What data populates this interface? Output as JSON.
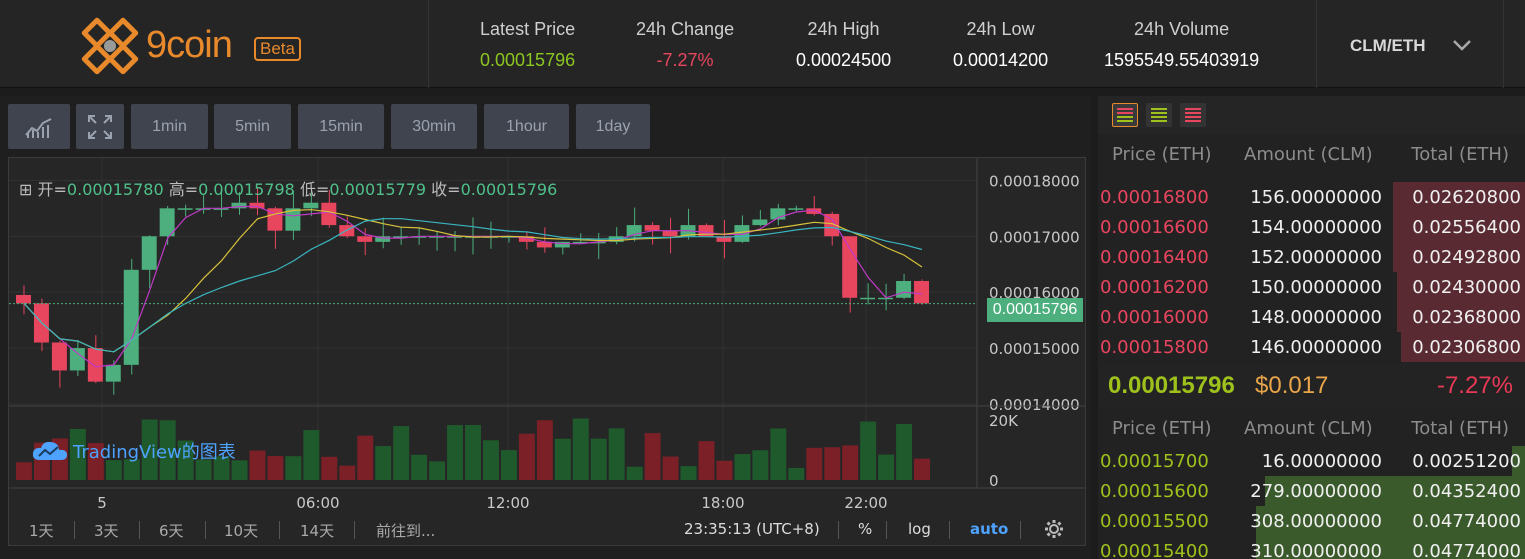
{
  "brand": {
    "name": "9coin",
    "badge": "Beta"
  },
  "ticker": {
    "latest_price": {
      "label": "Latest Price",
      "value": "0.00015796",
      "color": "#8cc620"
    },
    "change_24h": {
      "label": "24h Change",
      "value": "-7.27%",
      "color": "#e8455e"
    },
    "high_24h": {
      "label": "24h High",
      "value": "0.00024500",
      "color": "#ffffff"
    },
    "low_24h": {
      "label": "24h Low",
      "value": "0.00014200",
      "color": "#ffffff"
    },
    "volume_24h": {
      "label": "24h Volume",
      "value": "1595549.55403919",
      "color": "#ffffff"
    }
  },
  "pair": {
    "label": "CLM/ETH"
  },
  "toolbar": {
    "intervals": [
      "1min",
      "5min",
      "15min",
      "30min",
      "1hour",
      "1day"
    ]
  },
  "chart": {
    "ohlc": {
      "open_label": "开=",
      "open": "0.00015780",
      "high_label": "高=",
      "high": "0.00015798",
      "low_label": "低=",
      "low": "0.00015779",
      "close_label": "收=",
      "close": "0.00015796"
    },
    "price_axis": [
      "0.00018000",
      "0.00017000",
      "0.00016000",
      "0.00015000",
      "0.00014000"
    ],
    "last_price_tag": "0.00015796",
    "volume_axis": [
      "20K",
      "0"
    ],
    "time_axis": [
      "5",
      "06:00",
      "12:00",
      "18:00",
      "22:00"
    ],
    "watermark": "TradingView的图表",
    "colors": {
      "up": "#4caf7d",
      "down": "#e8455e",
      "ma1": "#c238c9",
      "ma2": "#d8c23a",
      "ma3": "#3ab5c0"
    }
  },
  "chart_data": {
    "type": "candlestick",
    "title": "",
    "ylim": [
      0.00014,
      0.000184
    ],
    "volume_ylim": [
      0,
      20000
    ],
    "xticks": [
      "5",
      "06:00",
      "12:00",
      "18:00",
      "22:00"
    ],
    "close_series": [
      0.000158,
      0.000151,
      0.000146,
      0.00015,
      0.000144,
      0.000147,
      0.000164,
      0.00017,
      0.000175,
      0.000175,
      0.000175,
      0.000175,
      0.000176,
      0.000175,
      0.000171,
      0.000175,
      0.000176,
      0.000172,
      0.00017,
      0.000169,
      0.00017,
      0.00017,
      0.00017,
      0.00017,
      0.00017,
      0.00017,
      0.00017,
      0.00017,
      0.000169,
      0.000168,
      0.000169,
      0.000169,
      0.000169,
      0.00017,
      0.000172,
      0.000171,
      0.00017,
      0.000172,
      0.00017,
      0.000169,
      0.000172,
      0.000173,
      0.000175,
      0.000175,
      0.000174,
      0.00017,
      0.000159,
      0.000159,
      0.000159,
      0.000162,
      0.000158
    ]
  },
  "bottom_bar": {
    "ranges": [
      "1天",
      "3天",
      "6天",
      "10天",
      "14天"
    ],
    "goto": "前往到...",
    "clock": "23:35:13 (UTC+8)",
    "percent": "%",
    "log": "log",
    "auto": "auto"
  },
  "order_book": {
    "head": {
      "price": "Price (ETH)",
      "amount": "Amount (CLM)",
      "total": "Total (ETH)"
    },
    "asks": [
      {
        "price": "0.00016800",
        "amount": "156.00000000",
        "total": "0.02620800",
        "depth": 0.31
      },
      {
        "price": "0.00016600",
        "amount": "154.00000000",
        "total": "0.02556400",
        "depth": 0.31
      },
      {
        "price": "0.00016400",
        "amount": "152.00000000",
        "total": "0.02492800",
        "depth": 0.31
      },
      {
        "price": "0.00016200",
        "amount": "150.00000000",
        "total": "0.02430000",
        "depth": 0.3
      },
      {
        "price": "0.00016000",
        "amount": "148.00000000",
        "total": "0.02368000",
        "depth": 0.3
      },
      {
        "price": "0.00015800",
        "amount": "146.00000000",
        "total": "0.02306800",
        "depth": 0.29
      }
    ],
    "mid": {
      "price": "0.00015796",
      "usd": "$0.017",
      "change": "-7.27%"
    },
    "bids": [
      {
        "price": "0.00015700",
        "amount": "16.00000000",
        "total": "0.00251200",
        "depth": 0.03
      },
      {
        "price": "0.00015600",
        "amount": "279.00000000",
        "total": "0.04352400",
        "depth": 0.61
      },
      {
        "price": "0.00015500",
        "amount": "308.00000000",
        "total": "0.04774000",
        "depth": 0.63
      },
      {
        "price": "0.00015400",
        "amount": "310.00000000",
        "total": "0.04774000",
        "depth": 0.63
      }
    ],
    "colors": {
      "ask": "#e8455e",
      "bid": "#9ec11c",
      "ask_depth": "#5a2a33",
      "bid_depth": "#3a5a2c"
    }
  }
}
